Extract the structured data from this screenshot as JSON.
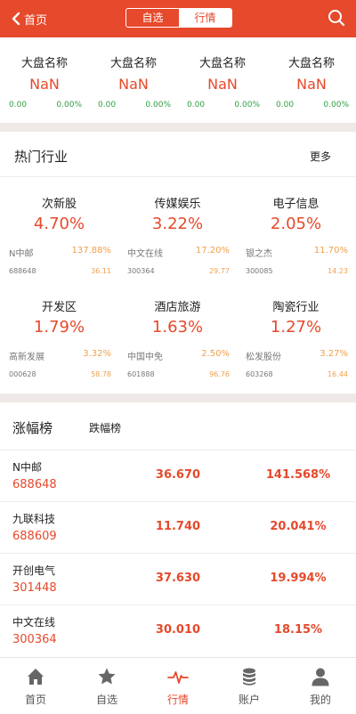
{
  "header": {
    "back_label": "首页",
    "segments": [
      "自选",
      "行情"
    ],
    "active_segment": "行情",
    "accent": "#e6492b"
  },
  "indices": [
    {
      "name": "大盘名称",
      "value": "NaN",
      "change": "0.00",
      "percent": "0.00%"
    },
    {
      "name": "大盘名称",
      "value": "NaN",
      "change": "0.00",
      "percent": "0.00%"
    },
    {
      "name": "大盘名称",
      "value": "NaN",
      "change": "0.00",
      "percent": "0.00%"
    },
    {
      "name": "大盘名称",
      "value": "NaN",
      "change": "0.00",
      "percent": "0.00%"
    }
  ],
  "hot": {
    "title": "热门行业",
    "more_label": "更多",
    "items": [
      {
        "name": "次新股",
        "pct": "4.70%",
        "stock": "N中邮",
        "stock_pct": "137.88%",
        "code": "688648",
        "price": "36.11"
      },
      {
        "name": "传媒娱乐",
        "pct": "3.22%",
        "stock": "中文在线",
        "stock_pct": "17.20%",
        "code": "300364",
        "price": "29.77"
      },
      {
        "name": "电子信息",
        "pct": "2.05%",
        "stock": "银之杰",
        "stock_pct": "11.70%",
        "code": "300085",
        "price": "14.23"
      },
      {
        "name": "开发区",
        "pct": "1.79%",
        "stock": "高新发展",
        "stock_pct": "3.32%",
        "code": "000628",
        "price": "58.78"
      },
      {
        "name": "酒店旅游",
        "pct": "1.63%",
        "stock": "中国中免",
        "stock_pct": "2.50%",
        "code": "601888",
        "price": "96.76"
      },
      {
        "name": "陶瓷行业",
        "pct": "1.27%",
        "stock": "松发股份",
        "stock_pct": "3.27%",
        "code": "603268",
        "price": "16.44"
      }
    ]
  },
  "ranking": {
    "tabs": [
      "涨幅榜",
      "跌幅榜"
    ],
    "rows": [
      {
        "name": "N中邮",
        "code": "688648",
        "price": "36.670",
        "pct": "141.568%"
      },
      {
        "name": "九联科技",
        "code": "688609",
        "price": "11.740",
        "pct": "20.041%"
      },
      {
        "name": "开创电气",
        "code": "301448",
        "price": "37.630",
        "pct": "19.994%"
      },
      {
        "name": "中文在线",
        "code": "300364",
        "price": "30.010",
        "pct": "18.15%"
      }
    ]
  },
  "tabbar": {
    "items": [
      {
        "label": "首页",
        "icon": "home-icon"
      },
      {
        "label": "自选",
        "icon": "star-icon"
      },
      {
        "label": "行情",
        "icon": "pulse-icon"
      },
      {
        "label": "账户",
        "icon": "coins-icon"
      },
      {
        "label": "我的",
        "icon": "user-icon"
      }
    ],
    "active": "行情"
  }
}
